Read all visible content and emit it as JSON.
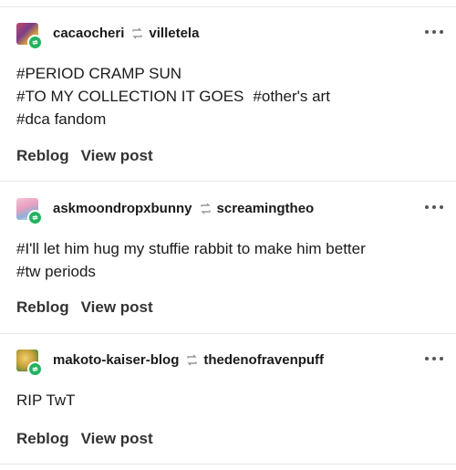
{
  "posts": [
    {
      "author": "cacaocheri",
      "source": "villetela",
      "tags": [
        [
          "#PERIOD CRAMP SUN"
        ],
        [
          "#TO MY COLLECTION IT GOES",
          "#other's art"
        ],
        [
          "#dca fandom"
        ]
      ],
      "reblog_label": "Reblog",
      "view_label": "View post"
    },
    {
      "author": "askmoondropxbunny",
      "source": "screamingtheo",
      "tags": [
        [
          "#I'll let him hug my stuffie rabbit to make him better"
        ],
        [
          "#tw periods"
        ]
      ],
      "reblog_label": "Reblog",
      "view_label": "View post"
    },
    {
      "author": "makoto-kaiser-blog",
      "source": "thedenofravenpuff",
      "text": "RIP TwT",
      "reblog_label": "Reblog",
      "view_label": "View post"
    }
  ],
  "colors": {
    "badge": "#23b35f",
    "divider": "#e6e6e6",
    "text": "#1a1a1a"
  },
  "icons": [
    "reblog-icon",
    "more-options-icon",
    "follow-badge-icon"
  ]
}
